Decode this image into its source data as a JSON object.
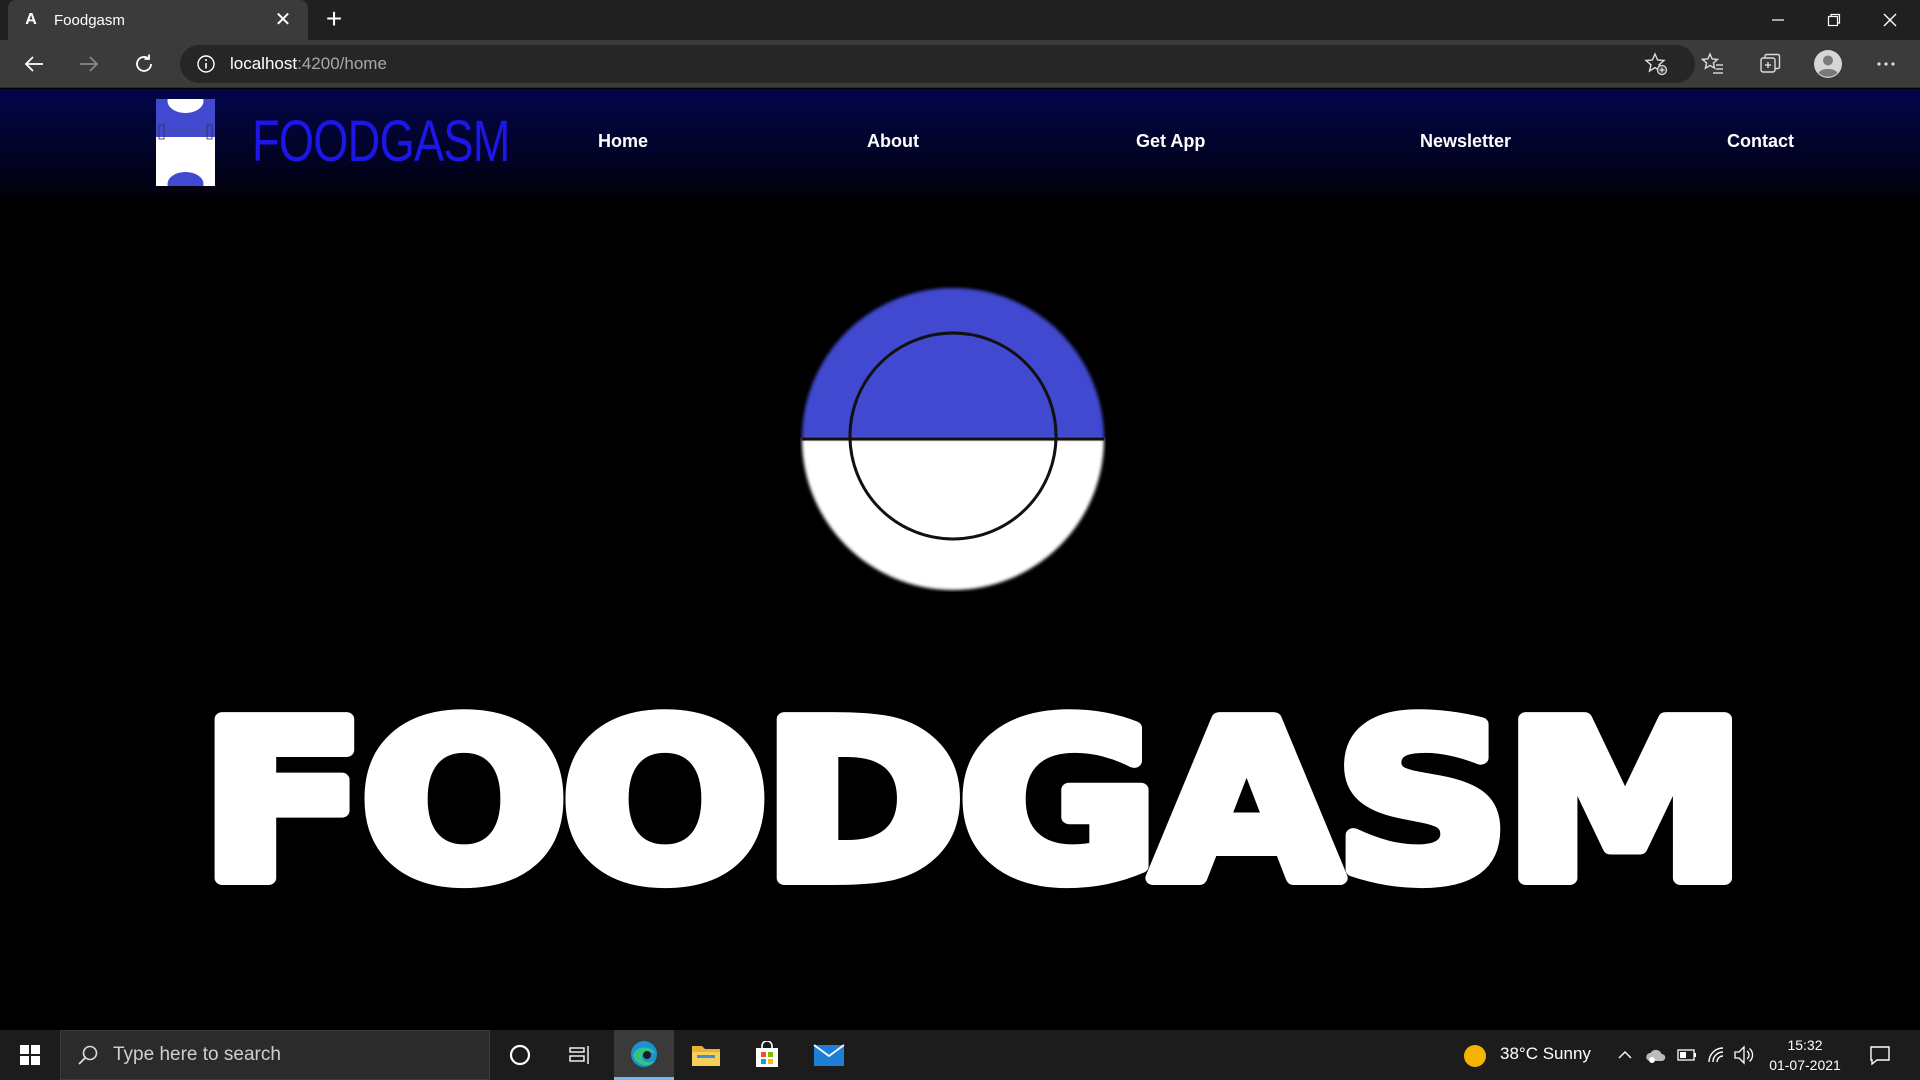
{
  "browser": {
    "tab_title": "Foodgasm",
    "tab_favicon": "angular-icon",
    "url_host": "localhost",
    "url_path": ":4200/home"
  },
  "site": {
    "brand": "FOODGASM",
    "nav": {
      "home": "Home",
      "about": "About",
      "get_app": "Get App",
      "newsletter": "Newsletter",
      "contact": "Contact"
    },
    "hero_title": "FOODGASM",
    "colors": {
      "brand_blue": "#1c16e6",
      "logo_blue": "#4049cf",
      "navbar_top": "#02064a"
    }
  },
  "taskbar": {
    "search_placeholder": "Type here to search",
    "weather": "38°C  Sunny",
    "time": "15:32",
    "date": "01-07-2021"
  }
}
